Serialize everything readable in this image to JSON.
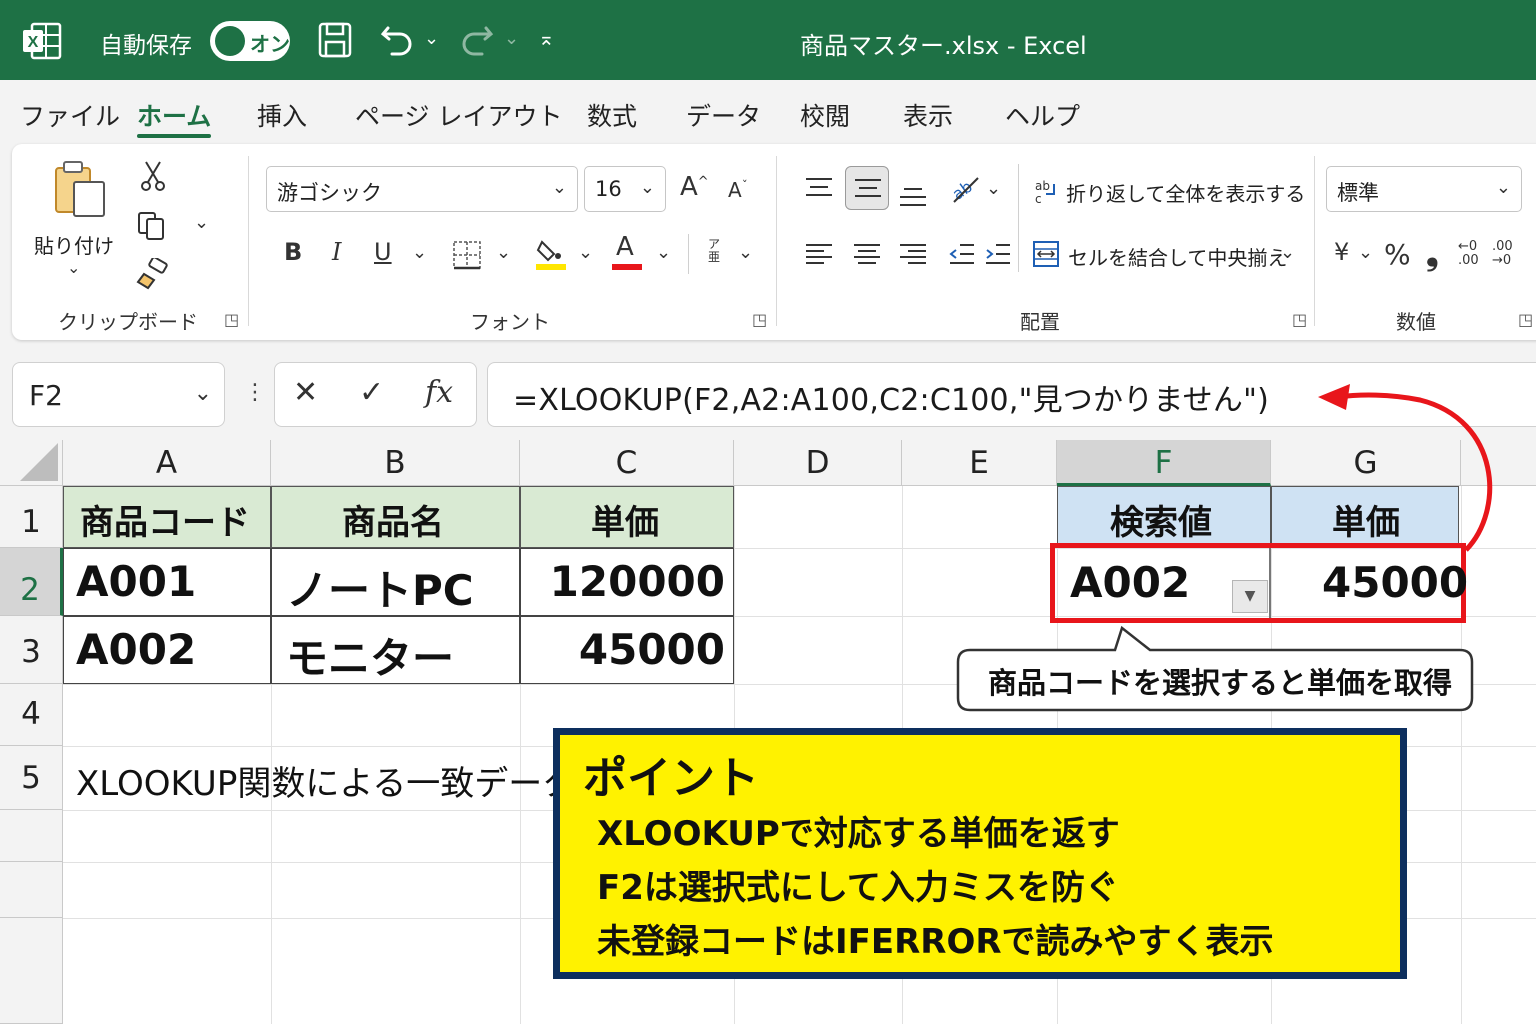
{
  "titlebar": {
    "autosave_label": "自動保存",
    "toggle_label": "オン",
    "document_title": "商品マスター.xlsx  -  Excel",
    "bg_color": "#1e7145"
  },
  "menu": {
    "tabs": [
      "ファイル",
      "ホーム",
      "挿入",
      "ページ レイアウト",
      "数式",
      "データ",
      "校閲",
      "表示",
      "ヘルプ"
    ],
    "active_tab": "ホーム"
  },
  "ribbon": {
    "clipboard": {
      "paste_label": "貼り付け",
      "group_label": "クリップボード"
    },
    "font": {
      "font_name": "游ゴシック",
      "font_size": "16",
      "group_label": "フォント",
      "bold": "B",
      "italic": "I",
      "underline": "U",
      "grow": "A",
      "shrink": "A",
      "font_color_label": "A",
      "phonetic_label": "ア亜"
    },
    "alignment": {
      "wrap_text": "折り返して全体を表示する",
      "merge_center": "セルを結合して中央揃え",
      "group_label": "配置"
    },
    "number": {
      "format": "標準",
      "group_label": "数値",
      "currency": "¥",
      "percent": "%",
      "comma": "❟",
      "inc_decimal": "←0 .00",
      "dec_decimal": ".00 →0"
    }
  },
  "formula_bar": {
    "name_box": "F2",
    "cancel": "✕",
    "enter": "✓",
    "fx": "fx",
    "formula": "=XLOOKUP(F2,A2:A100,C2:C100,\"見つかりません\")"
  },
  "columns": [
    "A",
    "B",
    "C",
    "D",
    "E",
    "F",
    "G"
  ],
  "rows": [
    "1",
    "2",
    "3",
    "4",
    "5"
  ],
  "table": {
    "headers": [
      "商品コード",
      "商品名",
      "単価"
    ],
    "rows": [
      [
        "A001",
        "ノートPC",
        "120000"
      ],
      [
        "A002",
        "モニター",
        "45000"
      ]
    ]
  },
  "lookup": {
    "headers": [
      "検索値",
      "単価"
    ],
    "search_value": "A002",
    "result": "45000"
  },
  "a5_text": "XLOOKUP関数による一致データ",
  "callout": "商品コードを選択すると単価を取得",
  "point": {
    "title": "ポイント",
    "lines": [
      "XLOOKUPで対応する単価を返す",
      "F2は選択式にして入力ミスを防ぐ",
      "未登録コードはIFERRORで読みやすく表示"
    ]
  },
  "colors": {
    "excel_green": "#1e7145",
    "header_green": "#d9ead3",
    "header_blue": "#cfe2f3",
    "highlight_red": "#e8161b",
    "point_yellow": "#fff200",
    "point_border": "#0d2f5e"
  }
}
